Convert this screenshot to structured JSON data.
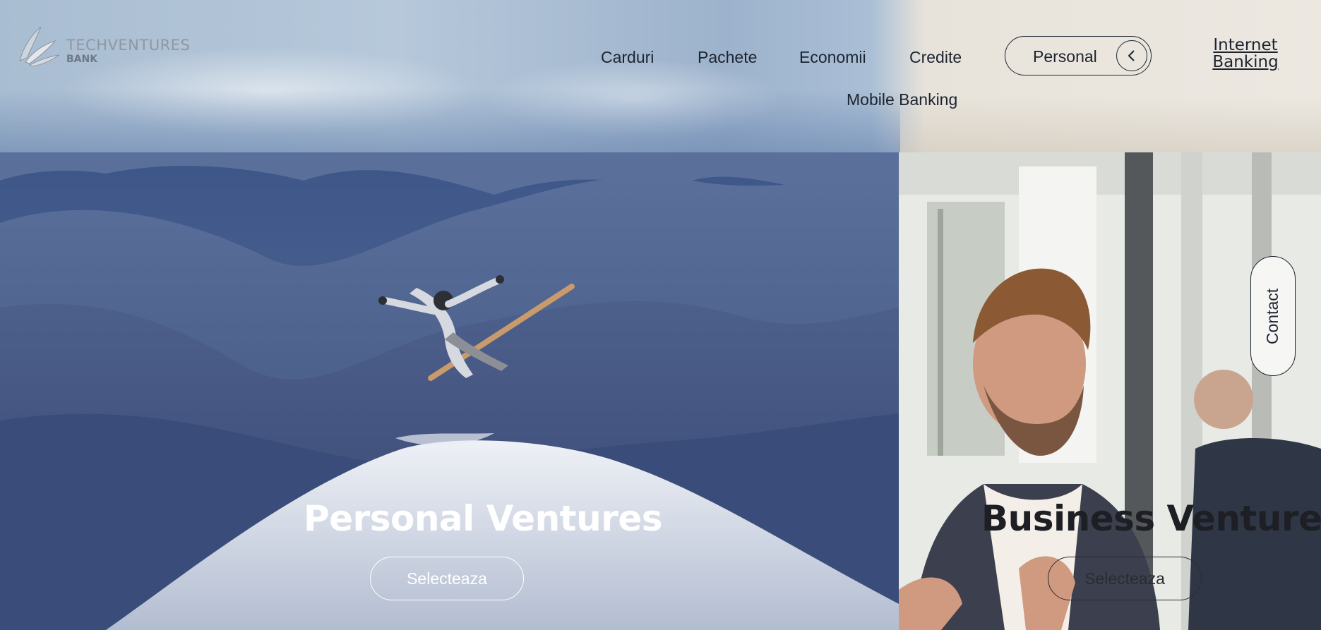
{
  "brand": {
    "name": "TECHVENTURES",
    "sub": "BANK"
  },
  "nav": {
    "items": [
      "Carduri",
      "Pachete",
      "Economii",
      "Credite",
      "Mobile Banking"
    ],
    "segment_label": "Personal",
    "internet_banking_line1": "Internet",
    "internet_banking_line2": "Banking"
  },
  "heroes": {
    "personal": {
      "title": "Personal Ventures",
      "button": "Selecteaza"
    },
    "business": {
      "title": "Business Ventures",
      "button": "Selecteaza"
    }
  },
  "contact_label": "Contact",
  "icons": {
    "logo": "wing-logo-icon",
    "segment_toggle": "chevron-left-icon"
  },
  "colors": {
    "text_dark": "#1d2430",
    "text_light": "#ffffff"
  }
}
